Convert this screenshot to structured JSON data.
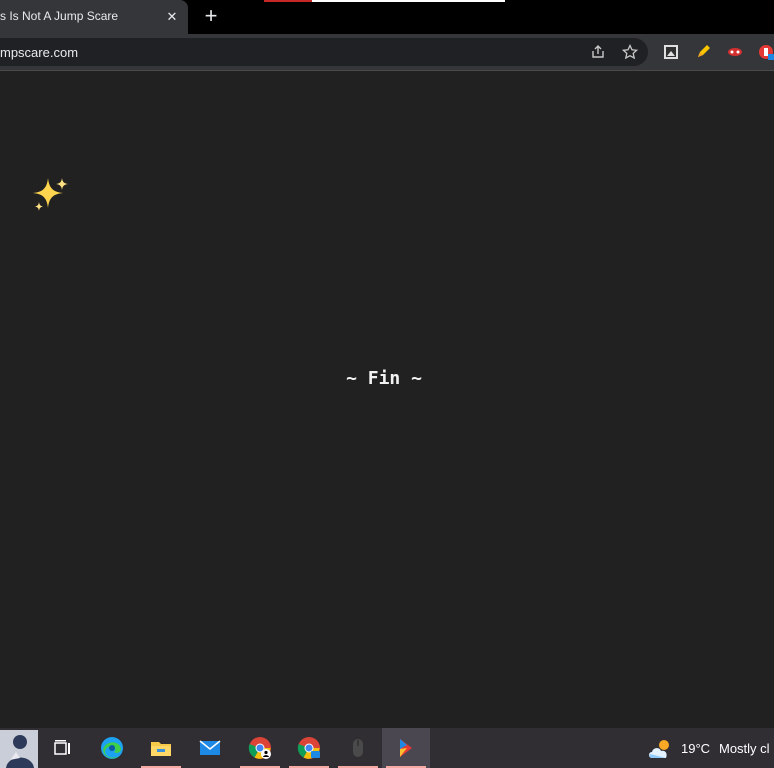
{
  "browser": {
    "tab": {
      "title": "s Is Not A Jump Scare",
      "close_glyph": "✕"
    },
    "new_tab_glyph": "+",
    "address": {
      "url": "mpscare.com"
    },
    "icons": {
      "share": "share-icon",
      "bookmark": "star-icon",
      "extensions": [
        "extension-icon",
        "pencil-extension-icon",
        "mask-extension-icon",
        "red-extension-icon"
      ]
    }
  },
  "page": {
    "sparkle": "sparkles-emoji",
    "text": "~ Fin ~"
  },
  "taskbar": {
    "items": [
      "avatar-app",
      "task-view",
      "edge",
      "file-explorer",
      "mail",
      "chrome-profile-1",
      "chrome-profile-2",
      "mouse-app",
      "bluestacks"
    ],
    "weather": {
      "temperature": "19°C",
      "condition": "Mostly cl"
    }
  },
  "colors": {
    "background": "#212121",
    "tabstrip": "#000000",
    "toolbar": "#35363a",
    "taskbar": "#302d33",
    "taskbar_accent": "#f4a9a3",
    "sparkle": "#ffd54f"
  }
}
